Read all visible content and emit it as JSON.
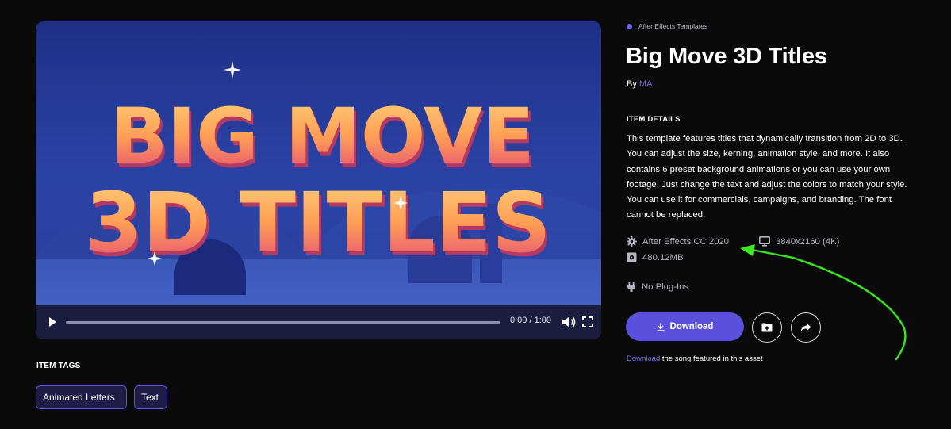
{
  "player": {
    "preview_text_line1": "BIG MOVE",
    "preview_text_line2": "3D TITLES",
    "time": "0:00 / 1:00",
    "progress": 0.0
  },
  "tags": {
    "heading": "ITEM TAGS",
    "items": [
      "Animated Letters",
      "Text"
    ]
  },
  "item": {
    "category": "After Effects Templates",
    "title": "Big Move 3D Titles",
    "by_prefix": "By",
    "author": "MA",
    "details_heading": "ITEM DETAILS",
    "description": "This template features titles that dynamically transition from 2D to 3D. You can adjust the size, kerning, animation style, and more. It also contains 6 preset background animations or you can use your own footage. Just change the text and adjust the colors to match your style. You can use it for commercials, campaigns, and branding. The font cannot be replaced.",
    "specs": {
      "software": "After Effects CC 2020",
      "resolution": "3840x2160 (4K)",
      "size": "480.12MB",
      "plugins": "No Plug-Ins"
    }
  },
  "actions": {
    "download_label": "Download"
  },
  "song": {
    "link_text": "Download",
    "rest_text": " the song featured in this asset"
  },
  "colors": {
    "accent": "#5b50dc",
    "link": "#7b6ef0",
    "annotation": "#38e81c",
    "background": "#0a0a0b"
  },
  "icons": [
    "play-icon",
    "volume-icon",
    "fullscreen-icon",
    "gear-icon",
    "monitor-icon",
    "disk-icon",
    "plug-icon",
    "download-icon",
    "folder-plus-icon",
    "share-icon"
  ]
}
